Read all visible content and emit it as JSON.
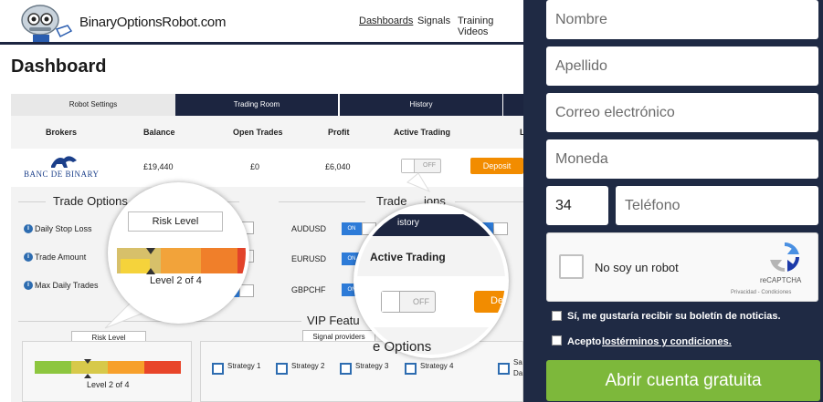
{
  "header": {
    "logo_text": "BinaryOptionsRobot.com",
    "nav": [
      "Dashboards",
      "Signals",
      "Training Videos"
    ]
  },
  "page_title": "Dashboard",
  "tabs": [
    "Robot Settings",
    "Trading Room",
    "History"
  ],
  "brokers_table": {
    "headers": [
      "Brokers",
      "Balance",
      "Open Trades",
      "Profit",
      "Active Trading",
      "L"
    ],
    "row": {
      "broker": "BANC DE BINARY",
      "balance": "£19,440",
      "open_trades": "£0",
      "profit": "£6,040",
      "toggle": "OFF",
      "deposit": "Deposit"
    }
  },
  "trade_options": {
    "title": "Trade Options",
    "rows": [
      "Daily Stop Loss",
      "Trade Amount",
      "Max Daily Trades"
    ],
    "risk_level_label": "Risk Level",
    "level_text": "Level 2 of 4",
    "level": 0.5,
    "partial_value": "f"
  },
  "pairs": {
    "title": "Trade Options",
    "title_partial": "Trade",
    "title_partial_2": "ions",
    "items": [
      "AUDUSD",
      "EURUSD",
      "GBPCHF"
    ],
    "on_label": "ON"
  },
  "vip": {
    "title": "VIP Featu",
    "signal_providers": "Signal providers",
    "risk_level_label": "Risk Level",
    "level_text": "Level 2 of 4",
    "strategies": [
      "Strategy 1",
      "Strategy 2",
      "Strategy 3",
      "Strategy 4"
    ],
    "extra_partial_1": "Sa",
    "extra_partial_2": "Da",
    "options_partial": "e Options"
  },
  "magnifier_small": {
    "risk_level_label": "Risk Level",
    "level_text": "Level 2 of 4"
  },
  "magnifier_large": {
    "history_partial": "istory",
    "active_trading": "Active Trading",
    "toggle": "OFF",
    "deposit_partial": "De"
  },
  "form": {
    "nombre": "Nombre",
    "apellido": "Apellido",
    "correo": "Correo electrónico",
    "moneda": "Moneda",
    "codigo": "34",
    "telefono": "Teléfono",
    "captcha_label": "No soy un robot",
    "captcha_brand": "reCAPTCHA",
    "captcha_links": "Privacidad - Condiciones",
    "newsletter": "Sí, me gustaría recibir su boletín de noticias.",
    "terms_prefix": "Acepto ",
    "terms_link": "lostérminos y condiciones.",
    "submit": "Abrir cuenta gratuita"
  },
  "colors": {
    "navy": "#1c2540",
    "panel_bg": "#1f2a44",
    "accent_blue": "#2d7bd8",
    "deposit_orange": "#f28c00",
    "submit_green": "#7db83b"
  }
}
